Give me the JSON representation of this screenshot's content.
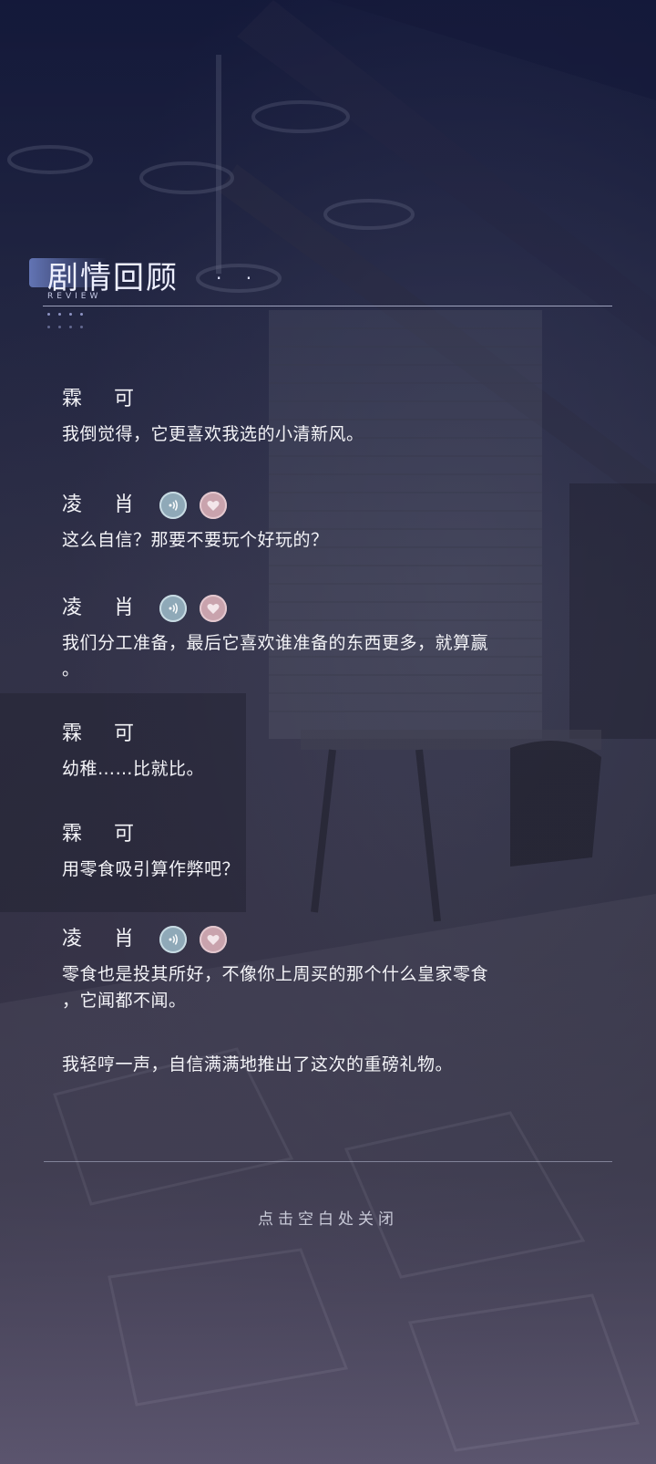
{
  "header": {
    "title": "剧情回顾",
    "dots": ". .",
    "subtitle": "REVIEW"
  },
  "entries": [
    {
      "speaker": "霖 可",
      "text": "我倒觉得，它更喜欢我选的小清新风。",
      "has_actions": false
    },
    {
      "speaker": "凌 肖",
      "text": "这么自信？那要不要玩个好玩的？",
      "has_actions": true
    },
    {
      "speaker": "凌 肖",
      "text": "我们分工准备，最后它喜欢谁准备的东西更多，就算赢",
      "text2": "。",
      "has_actions": true
    },
    {
      "speaker": "霖 可",
      "text": "幼稚……比就比。",
      "has_actions": false
    },
    {
      "speaker": "霖 可",
      "text": "用零食吸引算作弊吧？",
      "has_actions": false
    },
    {
      "speaker": "凌 肖",
      "text": "零食也是投其所好，不像你上周买的那个什么皇家零食",
      "text2": "，它闻都不闻。",
      "has_actions": true
    },
    {
      "speaker": "",
      "text": "我轻哼一声，自信满满地推出了这次的重磅礼物。",
      "has_actions": false
    }
  ],
  "footer": {
    "close_hint": "点击空白处关闭"
  },
  "icons": {
    "voice": "voice-play-icon",
    "heart": "heart-icon"
  },
  "colors": {
    "voice_button": "#8fa9b8",
    "heart_button": "#c9a3ad",
    "text": "#f4f4f8",
    "background": "#1b2040"
  }
}
